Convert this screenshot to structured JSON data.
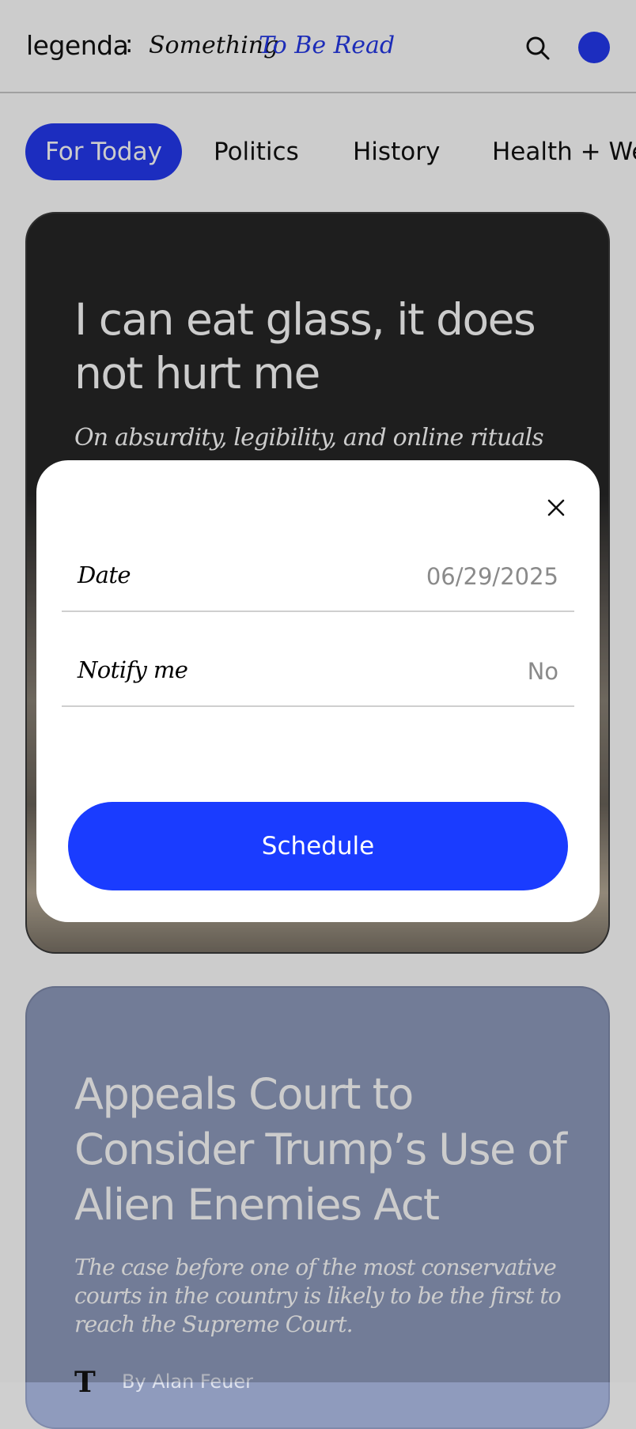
{
  "header": {
    "brand": "legenda",
    "separator": ":",
    "tagline_part1": "Something",
    "tagline_part2": "To Be Read"
  },
  "tabs": [
    {
      "label": "For Today",
      "active": true
    },
    {
      "label": "Politics",
      "active": false
    },
    {
      "label": "History",
      "active": false
    },
    {
      "label": "Health + Well",
      "active": false
    }
  ],
  "cards": [
    {
      "title": "I can eat glass, it does not hurt me",
      "subtitle": "On absurdity, legibility, and online rituals"
    },
    {
      "title": "Appeals Court to Consider Trump’s Use of Alien Enemies Act",
      "subtitle": "The case before one of the most conservative courts in the country is likely to be the first to reach the Supreme Court.",
      "source_logo": "T",
      "byline": "By Alan Feuer"
    }
  ],
  "modal": {
    "date_label": "Date",
    "date_value": "06/29/2025",
    "notify_label": "Notify me",
    "notify_value": "No",
    "button_label": "Schedule"
  },
  "colors": {
    "accent": "#1a3cff",
    "tab_active": "#2439ef"
  },
  "icons": [
    "search-icon",
    "close-icon",
    "avatar"
  ]
}
